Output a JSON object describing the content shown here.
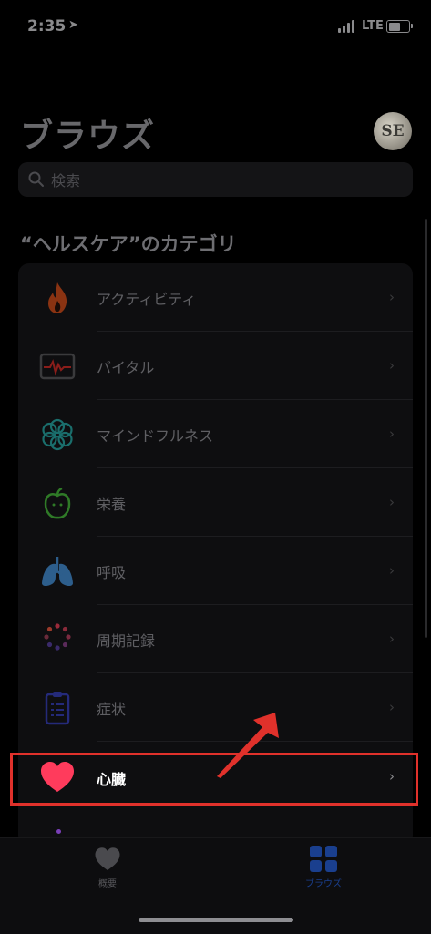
{
  "status_bar": {
    "time": "2:35",
    "network": "LTE"
  },
  "header": {
    "title": "ブラウズ",
    "avatar_initials": "SE"
  },
  "search": {
    "placeholder": "検索"
  },
  "section": {
    "title": "“ヘルスケア”のカテゴリ"
  },
  "categories": [
    {
      "label": "アクティビティ",
      "icon": "flame-icon",
      "color": "#e8562a"
    },
    {
      "label": "バイタル",
      "icon": "vitals-monitor-icon",
      "color": "#e0312b"
    },
    {
      "label": "マインドフルネス",
      "icon": "mindfulness-flower-icon",
      "color": "#2ec4c0"
    },
    {
      "label": "栄養",
      "icon": "apple-icon",
      "color": "#5ad14a"
    },
    {
      "label": "呼吸",
      "icon": "lungs-icon",
      "color": "#5aa8f0"
    },
    {
      "label": "周期記録",
      "icon": "cycle-tracking-icon",
      "color": "#ff3b6b"
    },
    {
      "label": "症状",
      "icon": "clipboard-icon",
      "color": "#3f4bd6"
    },
    {
      "label": "心臓",
      "icon": "heart-icon",
      "color": "#ff3b5c"
    }
  ],
  "tab_bar": {
    "tabs": [
      {
        "label": "概要",
        "icon": "heart-icon",
        "active": false
      },
      {
        "label": "ブラウズ",
        "icon": "grid-icon",
        "active": true
      }
    ]
  },
  "colors": {
    "highlight": "#e0312b",
    "active_tab": "#1a3f8e"
  }
}
